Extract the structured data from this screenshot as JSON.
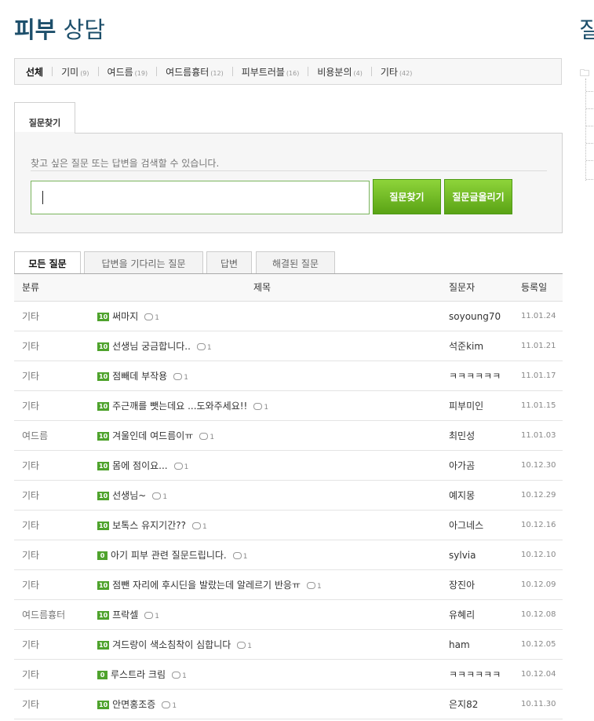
{
  "page": {
    "title_bold": "피부",
    "title_rest": "상담",
    "side_title": "질"
  },
  "categories": [
    {
      "label": "선체",
      "count": ""
    },
    {
      "label": "기미",
      "count": "(9)"
    },
    {
      "label": "여드름",
      "count": "(19)"
    },
    {
      "label": "여드름흉터",
      "count": "(12)"
    },
    {
      "label": "피부트러블",
      "count": "(16)"
    },
    {
      "label": "비용분의",
      "count": "(4)"
    },
    {
      "label": "기타",
      "count": "(42)"
    }
  ],
  "search": {
    "tab_label": "질문찾기",
    "hint": "찾고 싶은 질문 또는 답변을 검색할 수 있습니다.",
    "input_value": "",
    "find_button": "질문찾기",
    "post_button": "질문글올리기"
  },
  "filter_tabs": [
    "모든 질문",
    "답변을 기다리는 질문",
    "답변",
    "해결된 질문"
  ],
  "table": {
    "headers": {
      "category": "분류",
      "title": "제목",
      "author": "질문자",
      "date": "등록일"
    },
    "rows": [
      {
        "category": "기타",
        "badge": "10",
        "title": "써마지",
        "comments": "1",
        "author": "soyoung70",
        "date": "11.01.24"
      },
      {
        "category": "기타",
        "badge": "10",
        "title": "선생님 궁금합니다..",
        "comments": "1",
        "author": "석준kim",
        "date": "11.01.21"
      },
      {
        "category": "기타",
        "badge": "10",
        "title": "점빼데 부작용",
        "comments": "1",
        "author": "ㅋㅋㅋㅋㅋㅋ",
        "date": "11.01.17"
      },
      {
        "category": "기타",
        "badge": "10",
        "title": "주근깨를 뺏는데요 ...도와주세요!!",
        "comments": "1",
        "author": "피부미인",
        "date": "11.01.15"
      },
      {
        "category": "여드름",
        "badge": "10",
        "title": "겨울인데 여드름이ㅠ",
        "comments": "1",
        "author": "최민성",
        "date": "11.01.03"
      },
      {
        "category": "기타",
        "badge": "10",
        "title": "몸에 점이요...",
        "comments": "1",
        "author": "아가곰",
        "date": "10.12.30"
      },
      {
        "category": "기타",
        "badge": "10",
        "title": "선생님~",
        "comments": "1",
        "author": "예지몽",
        "date": "10.12.29"
      },
      {
        "category": "기타",
        "badge": "10",
        "title": "보톡스 유지기간??",
        "comments": "1",
        "author": "아그네스",
        "date": "10.12.16"
      },
      {
        "category": "기타",
        "badge": "0",
        "title": "아기 피부 관련 질문드립니다.",
        "comments": "1",
        "author": "sylvia",
        "date": "10.12.10"
      },
      {
        "category": "기타",
        "badge": "10",
        "title": "점뺀 자리에 후시딘을 발랐는데 알레르기 반응ㅠ",
        "comments": "1",
        "author": "장진아",
        "date": "10.12.09"
      },
      {
        "category": "여드름흉터",
        "badge": "10",
        "title": "프락셀",
        "comments": "1",
        "author": "유혜리",
        "date": "10.12.08"
      },
      {
        "category": "기타",
        "badge": "10",
        "title": "겨드랑이 색소침착이 심합니다",
        "comments": "1",
        "author": "ham",
        "date": "10.12.05"
      },
      {
        "category": "기타",
        "badge": "0",
        "title": "루스트라 크림",
        "comments": "1",
        "author": "ㅋㅋㅋㅋㅋㅋ",
        "date": "10.12.04"
      },
      {
        "category": "기타",
        "badge": "10",
        "title": "안면홍조증",
        "comments": "1",
        "author": "은지82",
        "date": "10.11.30"
      }
    ]
  }
}
